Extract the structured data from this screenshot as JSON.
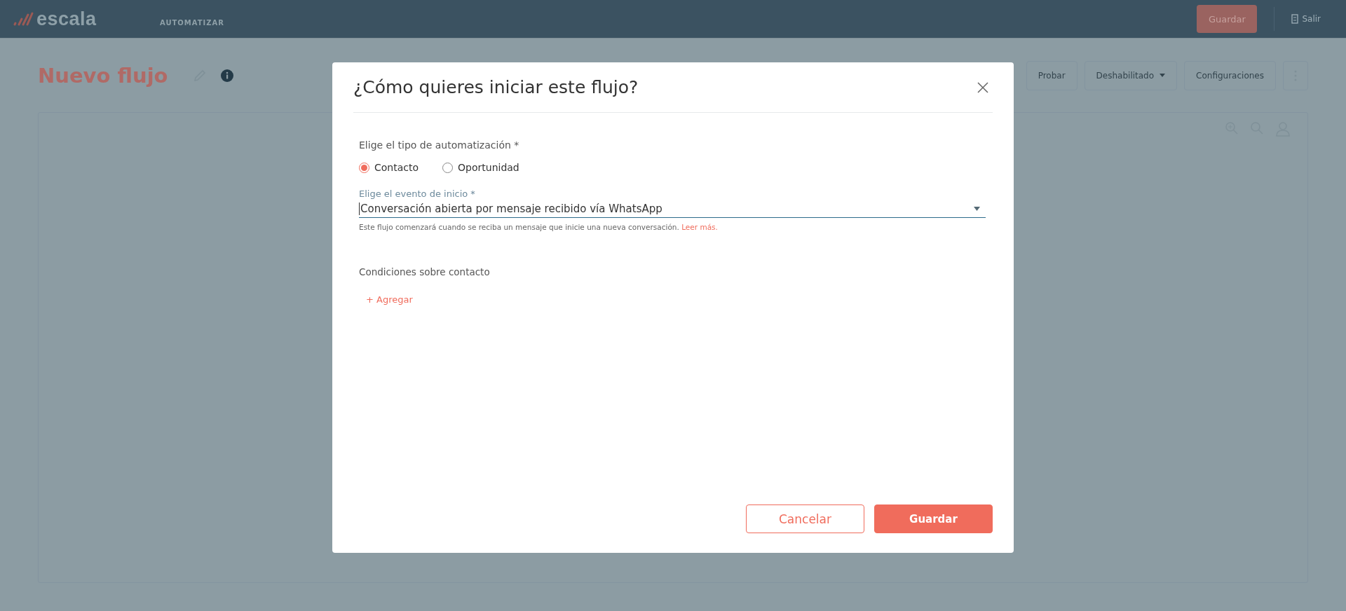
{
  "topbar": {
    "logo": "escala",
    "section": "AUTOMATIZAR",
    "save_button": "Guardar",
    "logout": "Salir"
  },
  "page": {
    "title": "Nuevo flujo",
    "toolbar": [
      {
        "kind": "button",
        "label": "Probar"
      },
      {
        "kind": "dropdown",
        "label": "Deshabilitado"
      },
      {
        "kind": "button",
        "label": "Configuraciones"
      }
    ]
  },
  "modal": {
    "title": "¿Cómo quieres iniciar este flujo?",
    "type_label": "Elige el tipo de automatización *",
    "type_options": [
      {
        "label": "Contacto",
        "selected": true
      },
      {
        "label": "Oportunidad",
        "selected": false
      }
    ],
    "event_label": "Elige el evento de inicio *",
    "event_value": "Conversación abierta por mensaje recibido vía WhatsApp",
    "helper_text": "Este flujo comenzará cuando se reciba un mensaje que inicie una nueva conversación.",
    "helper_link": "Leer más.",
    "conditions_label": "Condiciones sobre contacto",
    "add_link": "+ Agregar",
    "buttons": [
      {
        "kind": "secondary",
        "label": "Cancelar"
      },
      {
        "kind": "primary",
        "label": "Guardar"
      }
    ]
  }
}
